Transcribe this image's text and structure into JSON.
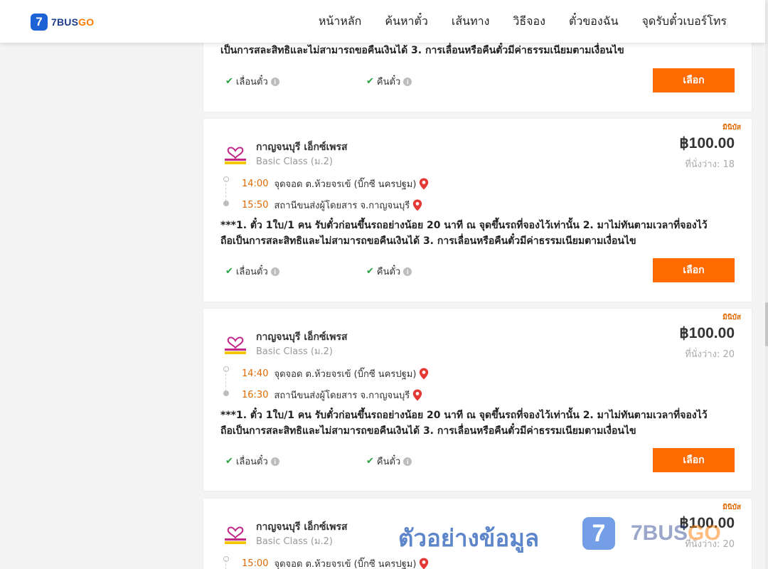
{
  "header": {
    "logo_digit": "7",
    "logo_text_main": "7BUS",
    "logo_text_accent": "GO",
    "nav": [
      "หน้าหลัก",
      "ค้นหาตั๋ว",
      "เส้นทาง",
      "วิธีจอง",
      "ตั๋วของฉัน",
      "จุดรับตั๋วเบอร์โทร"
    ]
  },
  "remark_text": "***1. ตั๋ว 1ใบ/1 คน รับตั๋วก่อนขึ้นรถอย่างน้อย 20 นาที ณ จุดขึ้นรถที่จองไว้เท่านั้น 2. มาไม่ทันตามเวลาที่จองไว้ ถือเป็นการสละสิทธิและไม่สามารถขอคืนเงินได้ 3. การเลื่อนหรือคืนตั๋วมีค่าธรรมเนียมตามเงื่อนไข",
  "remark_tail": "เป็นการสละสิทธิและไม่สามารถขอคืนเงินได้ 3. การเลื่อนหรือคืนตั๋วมีค่าธรรมเนียมตามเงื่อนไข",
  "features": {
    "change": "เลื่อนตั๋ว",
    "refund": "คืนตั๋ว"
  },
  "select_label": "เลือก",
  "trips": [
    {
      "tag": "มินิบัส",
      "operator": "กาญจนบุรี เอ็กซ์เพรส",
      "class": "Basic Class (ม.2)",
      "price": "฿100.00",
      "seats": "ที่นั่งว่าง: 18",
      "dep_time": "14:00",
      "dep_place": "จุดจอด ต.ห้วยจรเข้ (บิ๊กซี นครปฐม)",
      "arr_time": "15:50",
      "arr_place": "สถานีขนส่งผู้โดยสาร จ.กาญจนบุรี"
    },
    {
      "tag": "มินิบัส",
      "operator": "กาญจนบุรี เอ็กซ์เพรส",
      "class": "Basic Class (ม.2)",
      "price": "฿100.00",
      "seats": "ที่นั่งว่าง: 20",
      "dep_time": "14:40",
      "dep_place": "จุดจอด ต.ห้วยจรเข้ (บิ๊กซี นครปฐม)",
      "arr_time": "16:30",
      "arr_place": "สถานีขนส่งผู้โดยสาร จ.กาญจนบุรี"
    },
    {
      "tag": "มินิบัส",
      "operator": "กาญจนบุรี เอ็กซ์เพรส",
      "class": "Basic Class (ม.2)",
      "price": "฿100.00",
      "seats": "ที่นั่งว่าง: 20",
      "dep_time": "15:00",
      "dep_place": "จุดจอด ต.ห้วยจรเข้ (บิ๊กซี นครปฐม)"
    }
  ],
  "watermark": {
    "text": "ตัวอย่างข้อมูล",
    "badge_digit": "7",
    "brand_main": "7BUS",
    "brand_accent": "GO"
  },
  "colors": {
    "accent": "#ff6b00",
    "time": "#e06a00",
    "brand_blue": "#1e63d6",
    "check": "#27a03d",
    "pin": "#e53935"
  }
}
